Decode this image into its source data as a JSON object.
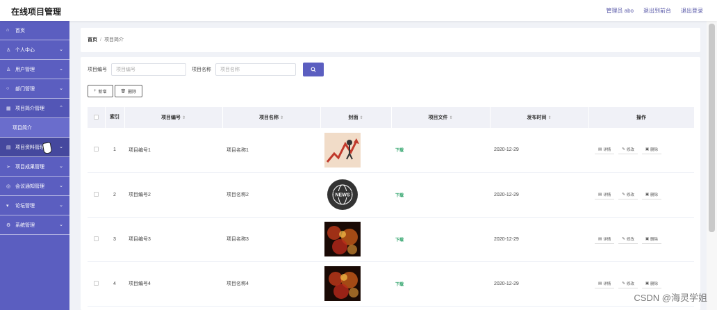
{
  "app": {
    "title": "在线项目管理",
    "admin": "管理员 abo",
    "back_front": "退出到前台",
    "logout": "退出登录"
  },
  "sidebar": {
    "items": [
      {
        "label": "首页",
        "icon": "home-icon",
        "chevron": ""
      },
      {
        "label": "个人中心",
        "icon": "user-icon",
        "chevron": "⌄"
      },
      {
        "label": "用户管理",
        "icon": "user-icon",
        "chevron": "⌄"
      },
      {
        "label": "部门管理",
        "icon": "circle-icon",
        "chevron": "⌄"
      },
      {
        "label": "项目简介管理",
        "icon": "grid-icon",
        "chevron": "⌃"
      }
    ],
    "submenu": {
      "label": "项目简介"
    },
    "items_after": [
      {
        "label": "项目资料管理",
        "icon": "doc-icon",
        "chevron": "⌄"
      },
      {
        "label": "项目成果管理",
        "icon": "send-icon",
        "chevron": "⌄"
      },
      {
        "label": "会议通知管理",
        "icon": "bell-icon",
        "chevron": "⌄"
      },
      {
        "label": "论坛管理",
        "icon": "forum-icon",
        "chevron": "⌄"
      },
      {
        "label": "系统管理",
        "icon": "gear-icon",
        "chevron": "⌄"
      }
    ]
  },
  "breadcrumb": {
    "home": "首页",
    "sep": "/",
    "current": "项目简介"
  },
  "search": {
    "label1": "项目编号",
    "placeholder1": "项目编号",
    "label2": "项目名称",
    "placeholder2": "项目名称"
  },
  "buttons": {
    "add": "新增",
    "delete": "删除",
    "add_icon": "+",
    "delete_icon": "🗑"
  },
  "table": {
    "headers": {
      "index": "索引",
      "code": "项目编号",
      "name": "项目名称",
      "cover": "封面",
      "file": "项目文件",
      "date": "发布时间",
      "ops": "操作"
    },
    "rows": [
      {
        "idx": "1",
        "code": "项目编号1",
        "name": "项目名称1",
        "file": "下载",
        "date": "2020-12-29"
      },
      {
        "idx": "2",
        "code": "项目编号2",
        "name": "项目名称2",
        "file": "下载",
        "date": "2020-12-29"
      },
      {
        "idx": "3",
        "code": "项目编号3",
        "name": "项目名称3",
        "file": "下载",
        "date": "2020-12-29"
      },
      {
        "idx": "4",
        "code": "项目编号4",
        "name": "项目名称4",
        "file": "下载",
        "date": "2020-12-29"
      }
    ],
    "actions": {
      "detail": "详情",
      "edit": "修改",
      "delete": "删除"
    }
  },
  "watermark": "CSDN @海灵学姐",
  "colors": {
    "sidebar": "#5b5ec0",
    "accent": "#5b5ec0",
    "download": "#2ea36a"
  }
}
